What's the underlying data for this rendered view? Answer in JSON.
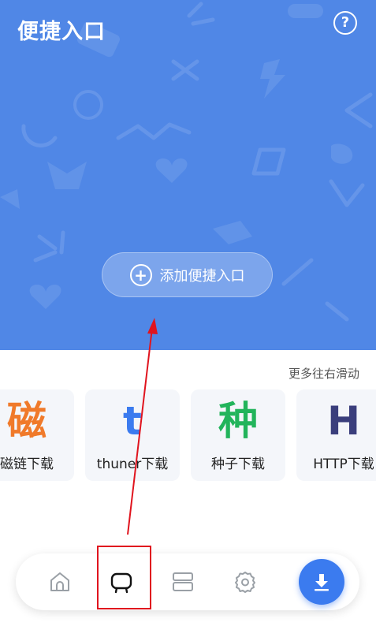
{
  "header": {
    "title": "便捷入口",
    "help_symbol": "?",
    "add_button_label": "添加便捷入口",
    "add_button_symbol": "+"
  },
  "hint_text": "更多往右滑动",
  "cards": [
    {
      "glyph": "磁",
      "label": "磁链下载",
      "color": "#F07A2A"
    },
    {
      "glyph": "t",
      "label": "thuner下载",
      "color": "#3B7BEF"
    },
    {
      "glyph": "种",
      "label": "种子下载",
      "color": "#22B45B"
    },
    {
      "glyph": "H",
      "label": "HTTP下载",
      "color": "#3A3E7C"
    }
  ],
  "bottom_nav": {
    "items": [
      "home-icon",
      "tv-icon",
      "layout-icon",
      "gear-icon",
      "download-icon"
    ],
    "highlighted_item": "tv-icon"
  },
  "colors": {
    "hero_background": "#5087E6",
    "accent": "#3B7BEF",
    "annotation": "#E0141E"
  }
}
